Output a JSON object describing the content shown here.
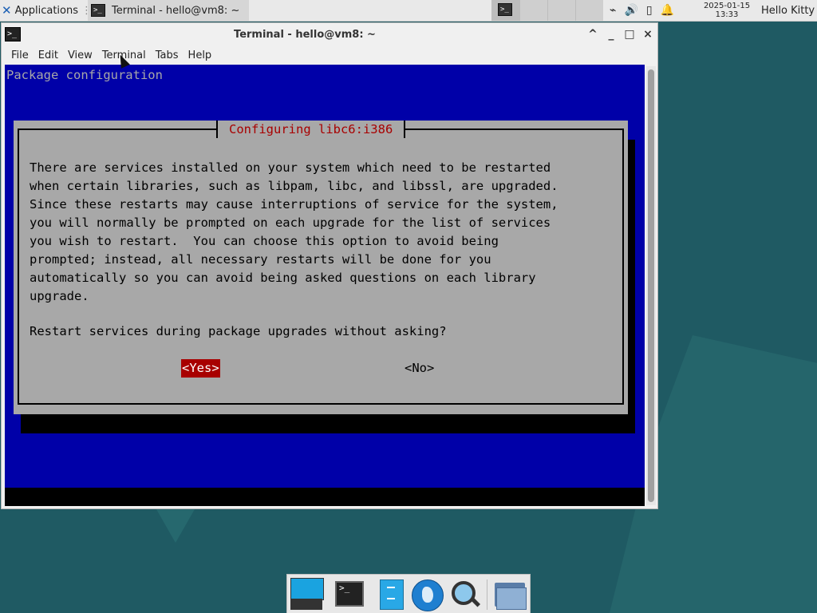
{
  "top_panel": {
    "applications_label": "Applications",
    "taskbar_window_title": "Terminal - hello@vm8: ~",
    "clock_date": "2025-01-15",
    "clock_time": "13:33",
    "user_name": "Hello Kitty",
    "tray_icons": [
      "network-icon",
      "volume-icon",
      "battery-icon",
      "notification-bell-icon"
    ]
  },
  "window": {
    "title": "Terminal - hello@vm8: ~",
    "buttons": [
      "^",
      "_",
      "□",
      "×"
    ]
  },
  "menubar": {
    "items": [
      "File",
      "Edit",
      "View",
      "Terminal",
      "Tabs",
      "Help"
    ]
  },
  "terminal": {
    "header": "Package configuration",
    "dialog_title": "Configuring libc6:i386",
    "body": "There are services installed on your system which need to be restarted\nwhen certain libraries, such as libpam, libc, and libssl, are upgraded.\nSince these restarts may cause interruptions of service for the system,\nyou will normally be prompted on each upgrade for the list of services\nyou wish to restart.  You can choose this option to avoid being\nprompted; instead, all necessary restarts will be done for you\nautomatically so you can avoid being asked questions on each library\nupgrade.",
    "question": "Restart services during package upgrades without asking?",
    "yes_label": "<Yes>",
    "no_label": "<No>"
  },
  "dock": {
    "items": [
      "desktop-icon",
      "terminal-icon",
      "file-manager-icon",
      "web-browser-icon",
      "search-icon",
      "folder-icon"
    ]
  },
  "colors": {
    "terminal_blue": "#0000a8",
    "dialog_gray": "#a8a8a8",
    "accent_red": "#a80000"
  }
}
